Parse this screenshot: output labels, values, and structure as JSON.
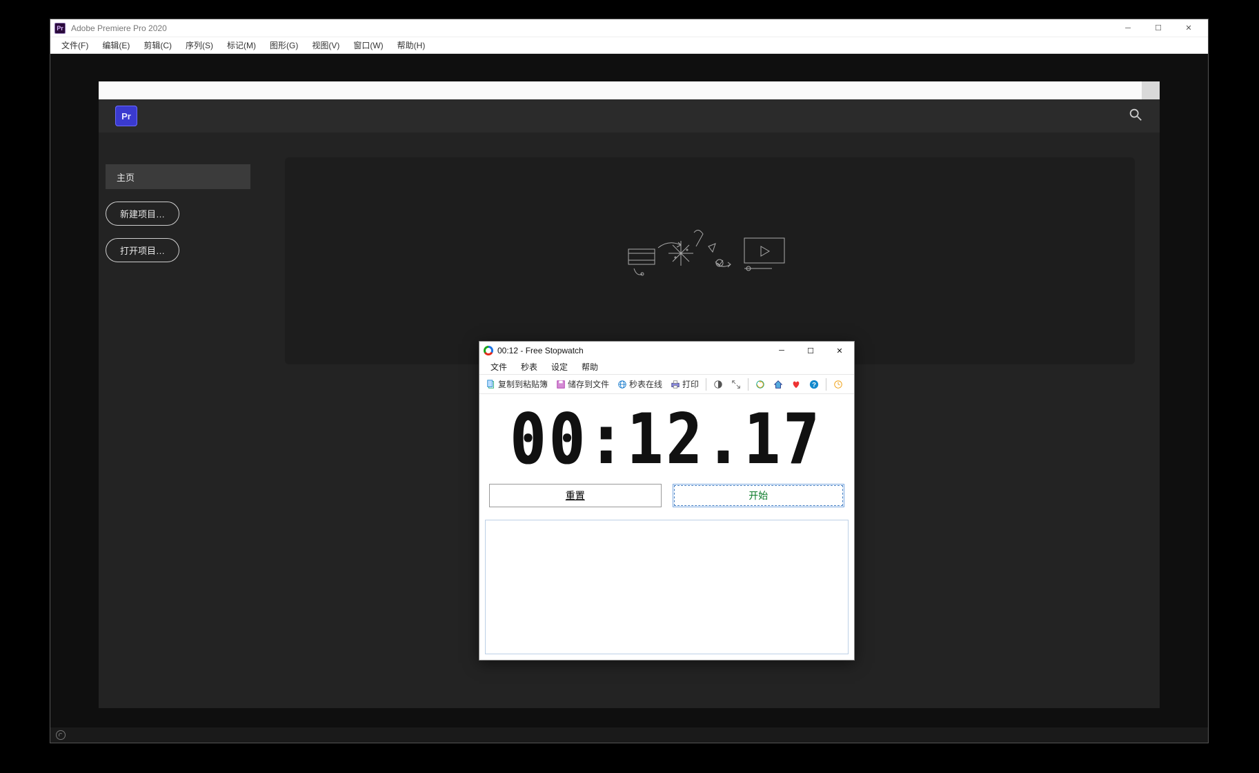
{
  "premiere": {
    "title": "Adobe Premiere Pro 2020",
    "menubar": [
      "文件(F)",
      "编辑(E)",
      "剪辑(C)",
      "序列(S)",
      "标记(M)",
      "图形(G)",
      "视图(V)",
      "窗口(W)",
      "帮助(H)"
    ],
    "logo_text": "Pr",
    "icon_text": "Pr",
    "home_tab": "主页",
    "btn_new": "新建项目…",
    "btn_open": "打开项目…"
  },
  "stopwatch": {
    "window_title": "00:12 - Free Stopwatch",
    "menubar": [
      "文件",
      "秒表",
      "设定",
      "帮助"
    ],
    "toolbar": {
      "copy": "复制到粘贴簿",
      "save": "储存到文件",
      "online": "秒表在线",
      "print": "打印"
    },
    "display": "00:12.17",
    "btn_reset": "重置",
    "btn_start": "开始"
  }
}
